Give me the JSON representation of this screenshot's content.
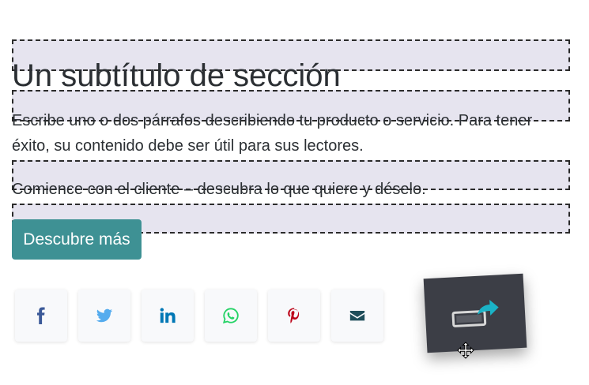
{
  "section": {
    "title": "Un subtítulo de sección",
    "paragraph_1": "Escribe uno o dos párrafos describiendo tu producto o servicio. Para tener éxito, su contenido debe ser útil para sus lectores.",
    "paragraph_2": "Comience con el cliente – descubra lo que quiere y déselo.",
    "cta_label": "Descubre más"
  },
  "share_buttons": [
    {
      "network": "facebook",
      "icon": "facebook-icon",
      "color": "#3b5998"
    },
    {
      "network": "twitter",
      "icon": "twitter-icon",
      "color": "#55acee"
    },
    {
      "network": "linkedin",
      "icon": "linkedin-icon",
      "color": "#0077b5"
    },
    {
      "network": "whatsapp",
      "icon": "whatsapp-icon",
      "color": "#25d366"
    },
    {
      "network": "pinterest",
      "icon": "pinterest-icon",
      "color": "#bd081c"
    },
    {
      "network": "email",
      "icon": "envelope-icon",
      "color": "#1f4e5a"
    }
  ],
  "colors": {
    "accent": "#3e9194",
    "dropzone": "#e6e4ef",
    "drag_card": "#3c3e46",
    "drag_arrow": "#1ab3c7"
  }
}
